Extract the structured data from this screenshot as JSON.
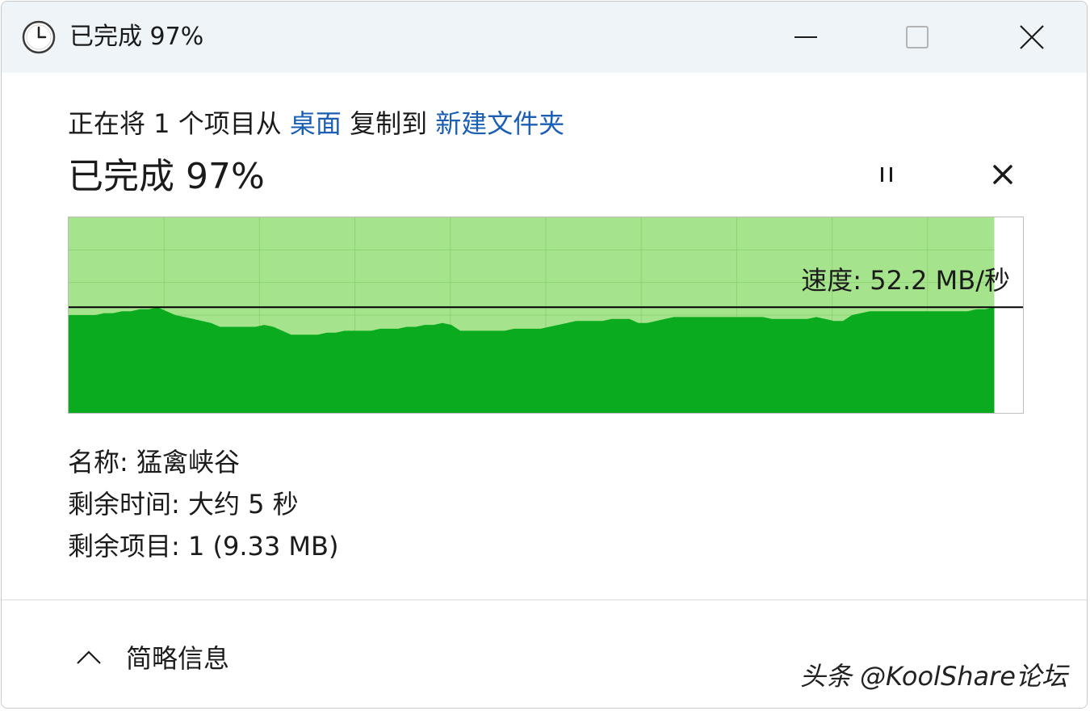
{
  "window": {
    "title": "已完成 97%",
    "icons": {
      "app": "clock-icon",
      "minimize": "minimize-icon",
      "maximize": "maximize-icon",
      "close": "close-icon"
    }
  },
  "copy": {
    "prefix": "正在将 1 个项目从",
    "source": "桌面",
    "middle": "复制到",
    "destination": "新建文件夹",
    "link_color": "#1a5fb4"
  },
  "progress": {
    "title": "已完成 97%",
    "percent": 97,
    "pause_icon": "pause-icon",
    "cancel_icon": "cancel-icon"
  },
  "graph": {
    "speed_label": "速度: 52.2 MB/秒",
    "speed_line_level": 0.54,
    "colors": {
      "fill_light": "#a6e38d",
      "fill_dark": "#0aab1e",
      "grid": "#8fd273",
      "line": "#000000"
    },
    "history": [
      0.5,
      0.5,
      0.5,
      0.5,
      0.51,
      0.51,
      0.52,
      0.52,
      0.53,
      0.53,
      0.54,
      0.52,
      0.5,
      0.49,
      0.48,
      0.47,
      0.46,
      0.44,
      0.44,
      0.44,
      0.44,
      0.44,
      0.45,
      0.44,
      0.42,
      0.4,
      0.4,
      0.4,
      0.4,
      0.41,
      0.41,
      0.42,
      0.42,
      0.42,
      0.42,
      0.43,
      0.43,
      0.43,
      0.44,
      0.44,
      0.45,
      0.45,
      0.46,
      0.45,
      0.42,
      0.42,
      0.42,
      0.42,
      0.42,
      0.42,
      0.43,
      0.43,
      0.43,
      0.43,
      0.44,
      0.45,
      0.46,
      0.47,
      0.47,
      0.47,
      0.47,
      0.48,
      0.48,
      0.48,
      0.46,
      0.46,
      0.47,
      0.48,
      0.49,
      0.49,
      0.49,
      0.49,
      0.49,
      0.49,
      0.49,
      0.49,
      0.49,
      0.49,
      0.49,
      0.48,
      0.48,
      0.48,
      0.48,
      0.48,
      0.49,
      0.48,
      0.47,
      0.47,
      0.5,
      0.51,
      0.52,
      0.52,
      0.52,
      0.52,
      0.52,
      0.52,
      0.52,
      0.52,
      0.52,
      0.52,
      0.52,
      0.52,
      0.53,
      0.53,
      0.54
    ]
  },
  "details": {
    "name": "名称: 猛禽峡谷",
    "time_remaining": "剩余时间: 大约 5 秒",
    "items_remaining": "剩余项目: 1 (9.33 MB)"
  },
  "footer": {
    "toggle_icon": "chevron-up-icon",
    "toggle_label": "简略信息",
    "watermark": "头条 @KoolShare论坛"
  }
}
